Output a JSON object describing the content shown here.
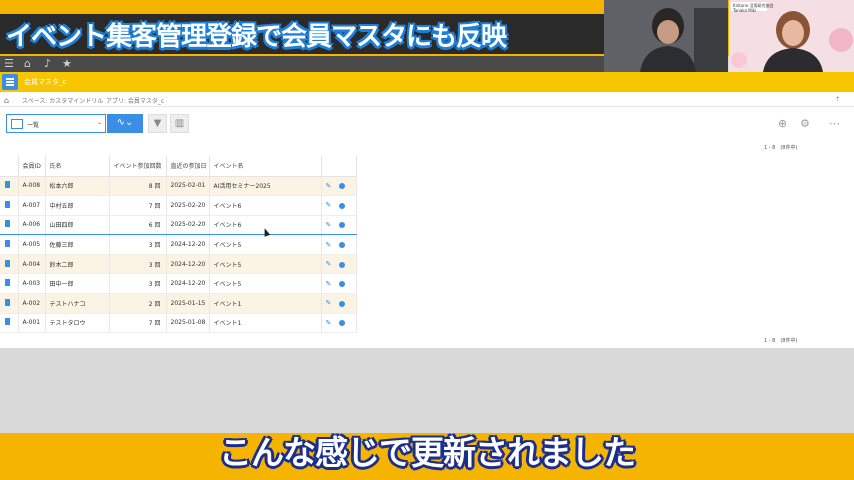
{
  "video": {
    "title_overlay": "イベント集客管理登録で会員マスタにも反映",
    "subtitle": "こんな感じで更新されました",
    "presenter_right_org": "Kintone 活用研究協会",
    "presenter_right_name": "Tanaka Miki"
  },
  "app": {
    "title": "会員マスタ_c",
    "breadcrumb_space": "スペース: カスタマインドリル",
    "breadcrumb_app": "アプリ: 会員マスタ_c",
    "view_name": "一覧",
    "pager_text": "1 - 8　(8件中)"
  },
  "icons": {
    "menu": "menu-icon",
    "home": "home-icon",
    "bell": "bell-icon",
    "star": "star-icon",
    "filter": "filter-icon",
    "graph": "graph-icon",
    "add": "plus-icon",
    "settings": "gear-icon",
    "more": "more-icon",
    "edit": "pencil-icon",
    "delete": "remove-icon",
    "detail": "document-icon"
  },
  "table": {
    "columns": [
      "会員ID",
      "氏名",
      "イベント参加回数",
      "直近の参加日",
      "イベント名"
    ],
    "rows": [
      {
        "id": "A-008",
        "name": "松本六郎",
        "count": "8 回",
        "date": "2025-02-01",
        "event": "AI活用セミナー2025"
      },
      {
        "id": "A-007",
        "name": "中村五郎",
        "count": "7 回",
        "date": "2025-02-20",
        "event": "イベント6"
      },
      {
        "id": "A-006",
        "name": "山田四郎",
        "count": "6 回",
        "date": "2025-02-20",
        "event": "イベント6"
      },
      {
        "id": "A-005",
        "name": "佐藤三郎",
        "count": "3 回",
        "date": "2024-12-20",
        "event": "イベント5"
      },
      {
        "id": "A-004",
        "name": "鈴木二郎",
        "count": "3 回",
        "date": "2024-12-20",
        "event": "イベント5"
      },
      {
        "id": "A-003",
        "name": "田中一郎",
        "count": "3 回",
        "date": "2024-12-20",
        "event": "イベント5"
      },
      {
        "id": "A-002",
        "name": "テストハナコ",
        "count": "2 回",
        "date": "2025-01-15",
        "event": "イベント1"
      },
      {
        "id": "A-001",
        "name": "テストタロウ",
        "count": "7 回",
        "date": "2025-01-08",
        "event": "イベント1"
      }
    ]
  },
  "colors": {
    "banner_yellow": "#f4b400",
    "kintone_yellow": "#f7c600",
    "accent_blue": "#3a8ee6"
  }
}
